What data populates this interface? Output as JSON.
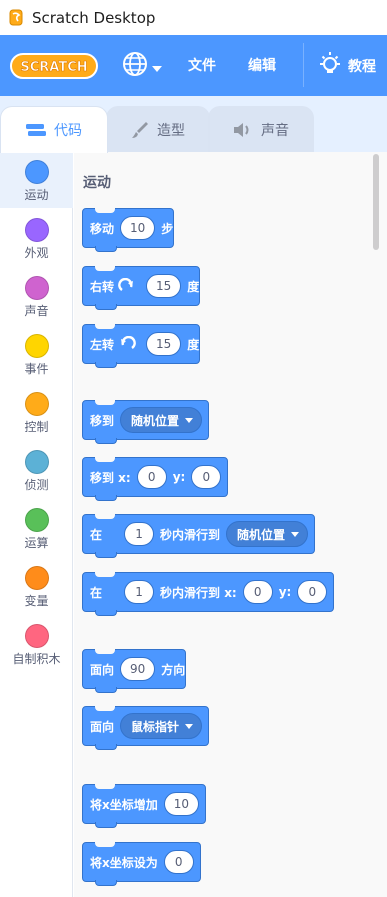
{
  "window": {
    "title": "Scratch Desktop"
  },
  "menubar": {
    "logo_text": "SCRATCH",
    "file": "文件",
    "edit": "编辑",
    "tutorials": "教程"
  },
  "tabs": [
    {
      "label": "代码",
      "active": true
    },
    {
      "label": "造型",
      "active": false
    },
    {
      "label": "声音",
      "active": false
    }
  ],
  "categories": [
    {
      "label": "运动",
      "color": "#4c97ff",
      "selected": true
    },
    {
      "label": "外观",
      "color": "#9966ff",
      "selected": false
    },
    {
      "label": "声音",
      "color": "#cf63cf",
      "selected": false
    },
    {
      "label": "事件",
      "color": "#ffd500",
      "selected": false
    },
    {
      "label": "控制",
      "color": "#ffab19",
      "selected": false
    },
    {
      "label": "侦测",
      "color": "#5cb1d6",
      "selected": false
    },
    {
      "label": "运算",
      "color": "#59c059",
      "selected": false
    },
    {
      "label": "变量",
      "color": "#ff8c1a",
      "selected": false
    },
    {
      "label": "自制积木",
      "color": "#ff6680",
      "selected": false
    }
  ],
  "palette": {
    "section_title": "运动",
    "blocks": {
      "move": {
        "a": "移动",
        "val": "10",
        "b": "步"
      },
      "turn_right": {
        "a": "右转",
        "val": "15",
        "b": "度"
      },
      "turn_left": {
        "a": "左转",
        "val": "15",
        "b": "度"
      },
      "goto": {
        "a": "移到",
        "menu": "随机位置"
      },
      "goto_xy": {
        "a": "移到 x:",
        "x": "0",
        "y_label": "y:",
        "y": "0"
      },
      "glide": {
        "a": "在",
        "val": "1",
        "b": "秒内滑行到",
        "menu": "随机位置"
      },
      "glide_xy": {
        "a": "在",
        "val": "1",
        "b": "秒内滑行到 x:",
        "x": "0",
        "y_label": "y:",
        "y": "0"
      },
      "point_dir": {
        "a": "面向",
        "val": "90",
        "b": "方向"
      },
      "point_towards": {
        "a": "面向",
        "menu": "鼠标指针"
      },
      "change_x": {
        "a": "将x坐标增加",
        "val": "10"
      },
      "set_x": {
        "a": "将x坐标设为",
        "val": "0"
      }
    }
  }
}
